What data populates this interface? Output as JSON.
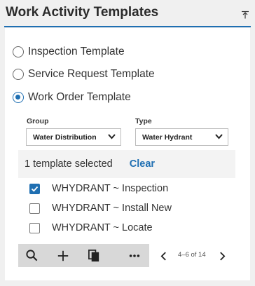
{
  "panel": {
    "title": "Work Activity Templates",
    "collapse_icon": "collapse-up-icon"
  },
  "template_types": [
    {
      "label": "Inspection Template",
      "selected": false
    },
    {
      "label": "Service Request Template",
      "selected": false
    },
    {
      "label": "Work Order Template",
      "selected": true
    }
  ],
  "filters": {
    "group": {
      "label": "Group",
      "value": "Water Distribution"
    },
    "type": {
      "label": "Type",
      "value": "Water Hydrant"
    }
  },
  "selection": {
    "summary": "1 template selected",
    "clear_label": "Clear"
  },
  "templates": [
    {
      "label": "WHYDRANT ~ Inspection",
      "checked": true
    },
    {
      "label": "WHYDRANT ~ Install New",
      "checked": false
    },
    {
      "label": "WHYDRANT ~ Locate",
      "checked": false
    }
  ],
  "toolbar": {
    "icons": [
      "search-icon",
      "add-icon",
      "copy-icon",
      "more-icon"
    ]
  },
  "pager": {
    "range": "4–6 of 14"
  },
  "colors": {
    "accent": "#1f6fb2",
    "background": "#f0f0f0",
    "toolbar": "#d8d8d8"
  }
}
